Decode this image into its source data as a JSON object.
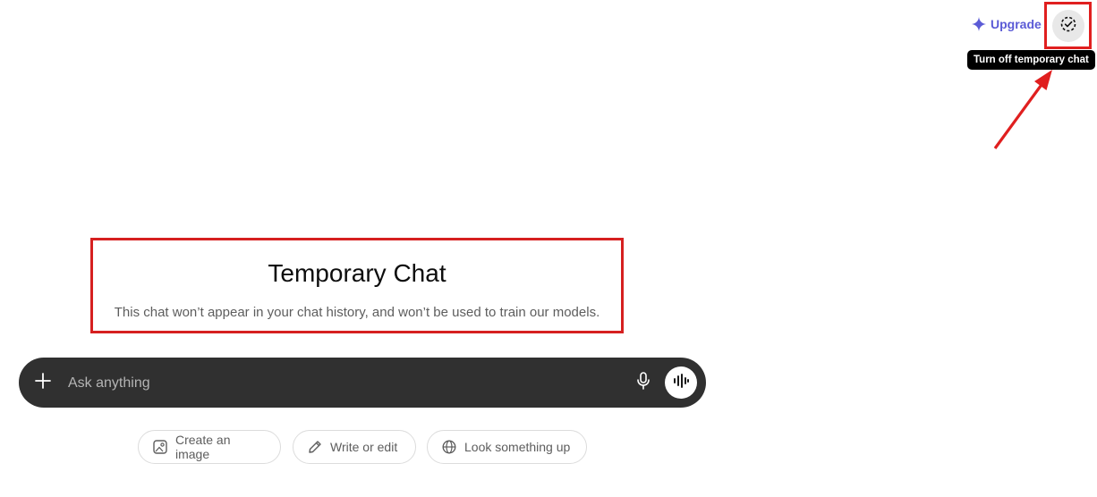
{
  "header": {
    "upgrade_label": "Upgrade",
    "upgrade_icon": "sparkle-icon",
    "temporary_chat_icon": "dashed-circle-check-icon",
    "tooltip": "Turn off temporary chat"
  },
  "main": {
    "title": "Temporary Chat",
    "subtitle": "This chat won’t appear in your chat history, and won’t be used to train our models."
  },
  "composer": {
    "placeholder": "Ask anything",
    "plus_icon": "plus-icon",
    "mic_icon": "microphone-icon",
    "voice_icon": "voice-waveform-icon"
  },
  "suggestions": [
    {
      "label": "Create an image",
      "icon": "image-icon"
    },
    {
      "label": "Write or edit",
      "icon": "pencil-icon"
    },
    {
      "label": "Look something up",
      "icon": "globe-icon"
    }
  ],
  "colors": {
    "accent": "#5b5bd6",
    "annotation_red": "#e01f1f",
    "composer_bg": "#303030"
  }
}
